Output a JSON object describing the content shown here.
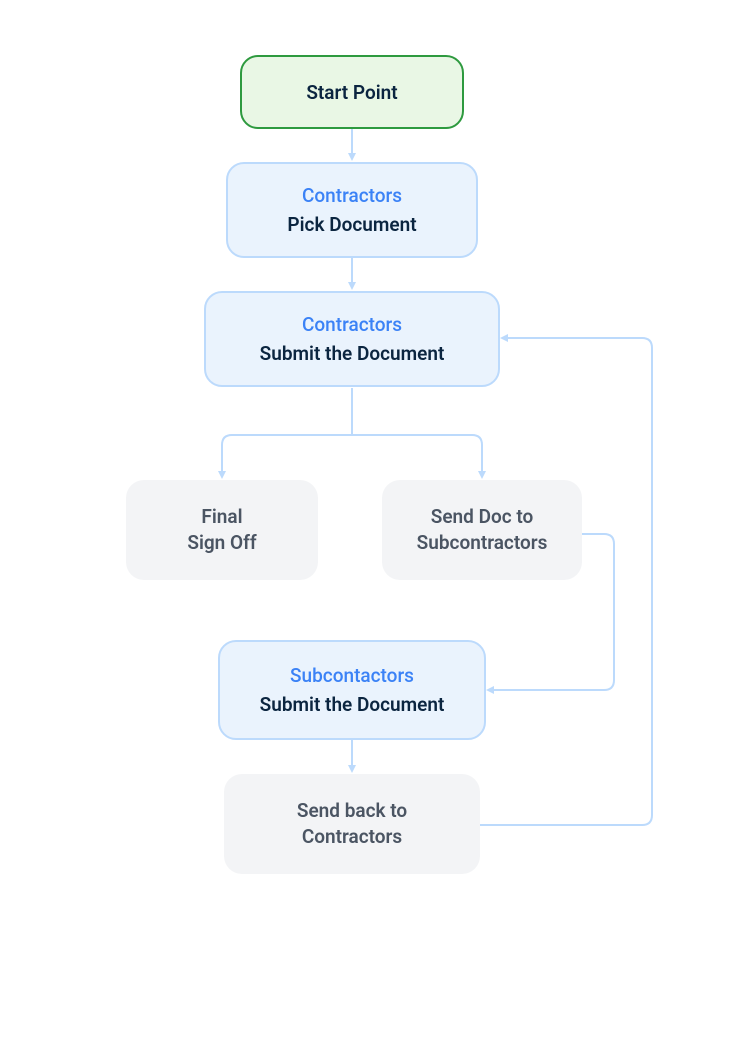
{
  "colors": {
    "start_fill": "#e9f7e5",
    "start_border": "#2e9a3f",
    "blue_fill": "#eaf3fd",
    "blue_border": "#bcdafc",
    "gray_fill": "#f3f4f6",
    "arrow": "#bcdafc",
    "role_text": "#3b82f6",
    "action_text": "#0b2540",
    "gray_text": "#4b5563"
  },
  "nodes": {
    "start": {
      "label": "Start Point"
    },
    "pick": {
      "role": "Contractors",
      "action": "Pick Document"
    },
    "submit_contractors": {
      "role": "Contractors",
      "action": "Submit the Document"
    },
    "final_signoff": {
      "line1": "Final",
      "line2": "Sign Off"
    },
    "send_subs": {
      "line1": "Send Doc to",
      "line2": "Subcontractors"
    },
    "submit_subs": {
      "role": "Subcontactors",
      "action": "Submit the Document"
    },
    "send_back": {
      "line1": "Send back to",
      "line2": "Contractors"
    }
  }
}
